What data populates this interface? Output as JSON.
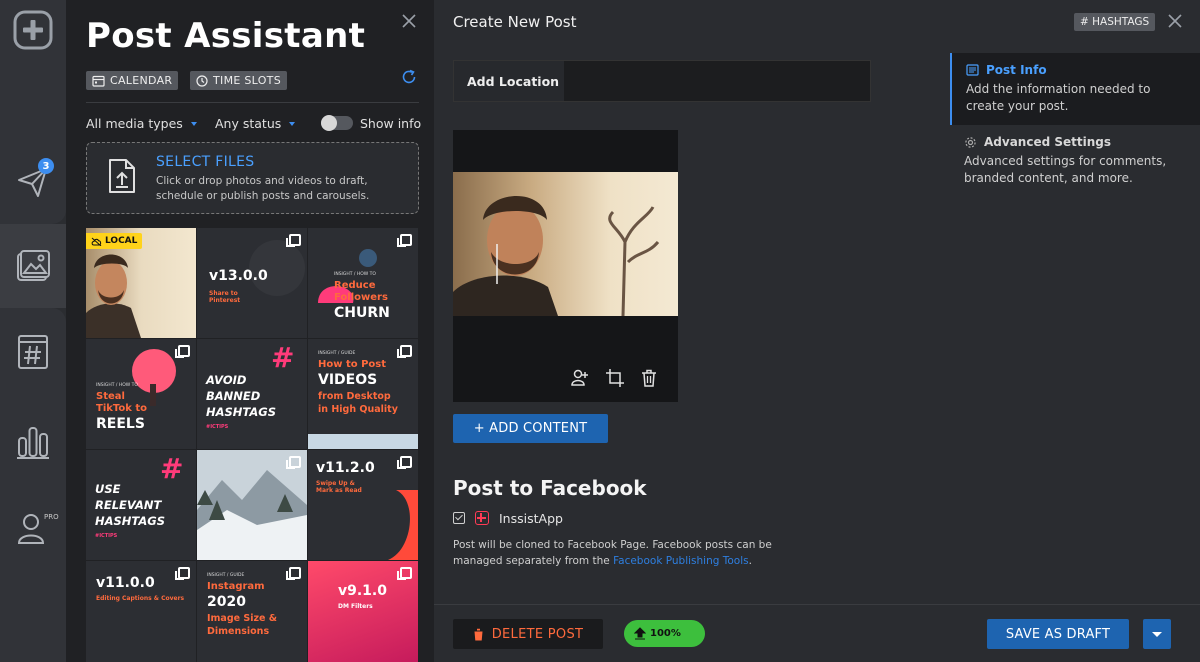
{
  "sidebar": {
    "notification_count": "3",
    "pro_label": "PRO",
    "icons": [
      "add-post-icon",
      "send-icon",
      "media-icon",
      "hashtag-icon",
      "analytics-icon",
      "profile-icon"
    ]
  },
  "assistant": {
    "title": "Post Assistant",
    "calendar_label": "CALENDAR",
    "timeslots_label": "TIME SLOTS",
    "filter_media": "All media types",
    "filter_status": "Any status",
    "show_info_label": "Show info",
    "dropzone_title": "SELECT FILES",
    "dropzone_desc": "Click or drop photos and videos to draft, schedule or publish posts and carousels.",
    "local_badge": "LOCAL",
    "tiles": [
      {
        "big": "v13.0.0",
        "sub": "Share to Pinterest"
      },
      {
        "kicker": "INSIGHT / HOW TO",
        "line1": "Reduce",
        "line2": "Followers",
        "line3": "CHURN"
      },
      {
        "kicker": "INSIGHT / HOW TO",
        "line1": "Steal",
        "line2": "TikTok to",
        "line3": "REELS"
      },
      {
        "line1": "AVOID",
        "line2": "BANNED",
        "line3": "HASHTAGS",
        "tag": "#ICTIPS"
      },
      {
        "kicker": "INSIGHT / GUIDE",
        "line1": "How to Post",
        "line2": "VIDEOS",
        "line3": "from Desktop",
        "line4": "in High Quality"
      },
      {
        "line1": "USE",
        "line2": "RELEVANT",
        "line3": "HASHTAGS",
        "tag": "#ICTIPS"
      },
      {
        "big": "v11.2.0",
        "sub": "Swipe Up & Mark as Read"
      },
      {
        "big": "v11.0.0",
        "sub": "Editing Captions & Covers"
      },
      {
        "kicker": "INSIGHT / GUIDE",
        "line1": "Instagram",
        "line2": "2020",
        "line3": "Image Size &",
        "line4": "Dimensions"
      },
      {
        "big": "v9.1.0",
        "sub": "DM Filters"
      }
    ]
  },
  "editor": {
    "title": "Create New Post",
    "hashtags_label": "# HASHTAGS",
    "location_label": "Add Location",
    "location_value": "",
    "add_content_label": "+ ADD CONTENT",
    "facebook_title": "Post to Facebook",
    "facebook_account": "InssistApp",
    "facebook_desc_prefix": "Post will be cloned to Facebook Page. Facebook posts can be managed separately from the ",
    "facebook_link": "Facebook Publishing Tools",
    "facebook_desc_suffix": ".",
    "panel": {
      "post_info_title": "Post Info",
      "post_info_desc": "Add the information needed to create your post.",
      "advanced_title": "Advanced Settings",
      "advanced_desc": "Advanced settings for comments, branded content, and more."
    },
    "delete_label": "DELETE POST",
    "progress_label": "100%",
    "progress_value": 100,
    "save_draft_label": "SAVE AS DRAFT"
  },
  "colors": {
    "accent": "#3d8ef0",
    "delete": "#ff6a3d",
    "progress": "#3dbf3d",
    "local_badge": "#ffd31a"
  }
}
